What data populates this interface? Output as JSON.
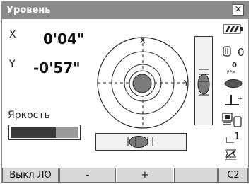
{
  "window": {
    "title": "Уровень",
    "close_label": "×"
  },
  "readings": {
    "x_label": "X",
    "x_value": "0'04\"",
    "y_label": "Y",
    "y_value": "-0'57\""
  },
  "brightness": {
    "label": "Яркость",
    "level": 4,
    "max": 6
  },
  "circular_level": {
    "x_axis_label": "X",
    "y_axis_label": "Y"
  },
  "status_panel": {
    "prism_constant": "0",
    "ppm_value": "0",
    "ppm_unit": "PPM",
    "target_index": "1"
  },
  "softkeys": [
    {
      "label": "Выкл ЛО"
    },
    {
      "label": "-"
    },
    {
      "label": "+"
    },
    {
      "label": ""
    },
    {
      "label": "C2"
    }
  ],
  "colors": {
    "titlebar": "#8a8a8a",
    "softkey_bg": "#d8d8d8",
    "bubble": "#7a7a7a",
    "brightness_on": "#3a3a3a",
    "brightness_off": "#9a9a9a"
  }
}
